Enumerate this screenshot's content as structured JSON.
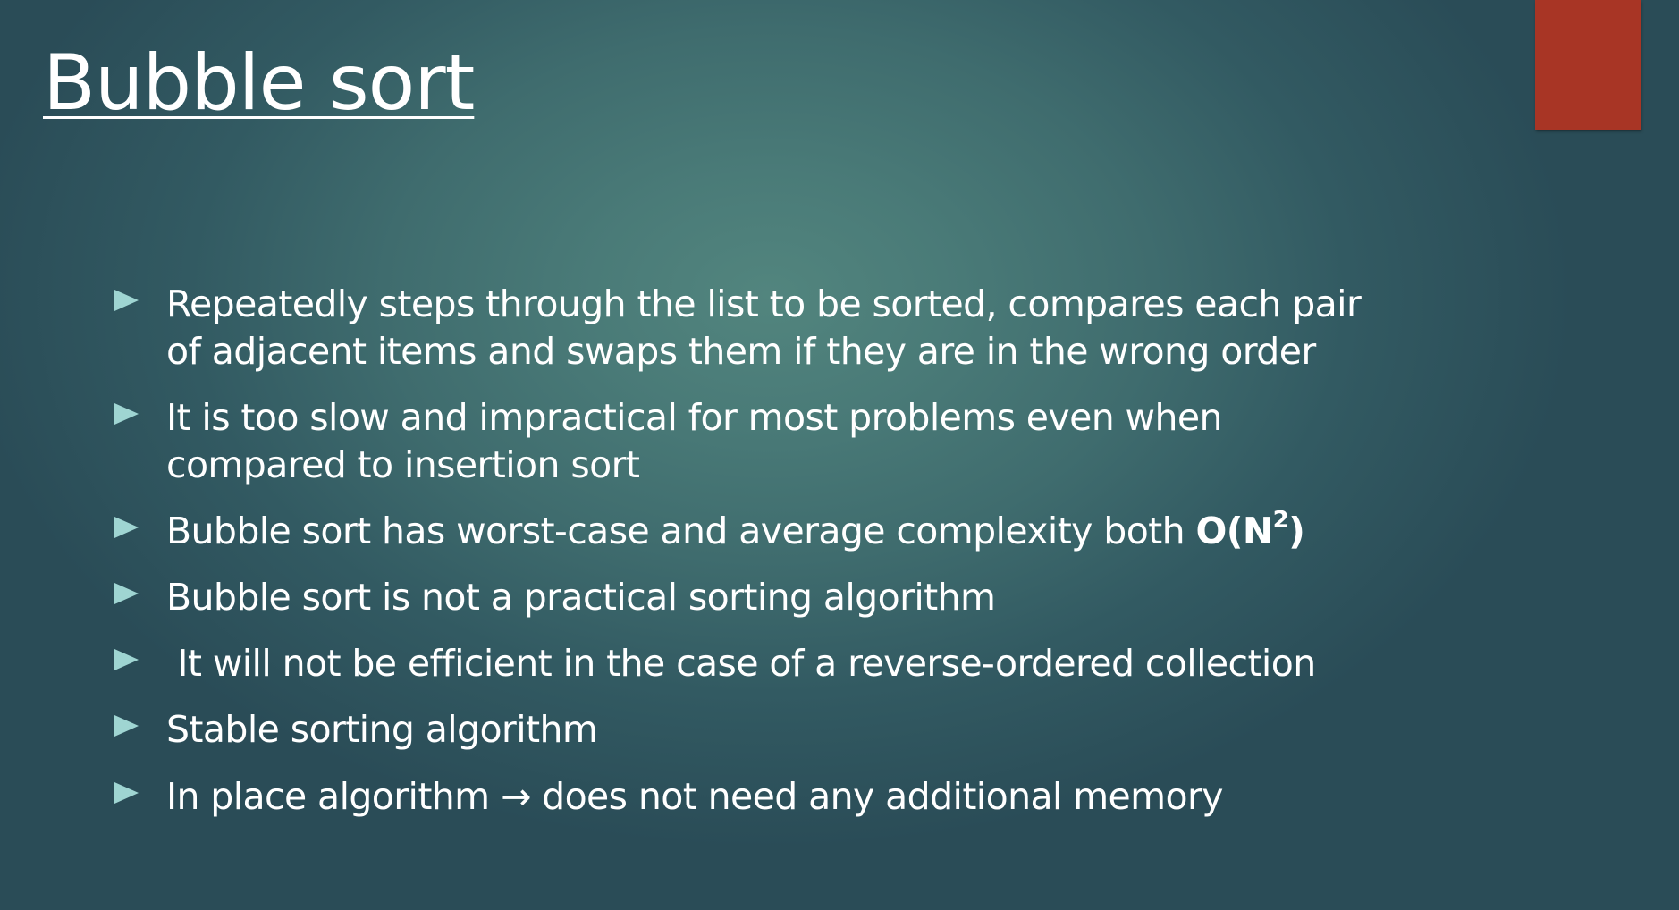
{
  "slide": {
    "title": "Bubble sort",
    "accent_color": "#a83525",
    "bullet_marker_color": "#9fd5d2",
    "bullets": [
      {
        "line1": "Repeatedly steps through the list to be sorted, compares each pair",
        "line2": "of adjacent items and swaps them if they are in the wrong order"
      },
      {
        "line1": "It is too slow and impractical for most problems even when",
        "line2": "compared to insertion sort"
      },
      {
        "text_before": "Bubble sort has worst-case and average complexity both ",
        "complexity_open": "O(N",
        "complexity_exponent": "2",
        "complexity_close": ")"
      },
      {
        "text": "Bubble sort is not a practical sorting algorithm"
      },
      {
        "text": " It will not be efficient in the case of a reverse-ordered collection"
      },
      {
        "text": "Stable sorting algorithm"
      },
      {
        "text": "In place algorithm → does not need any additional memory"
      }
    ]
  }
}
